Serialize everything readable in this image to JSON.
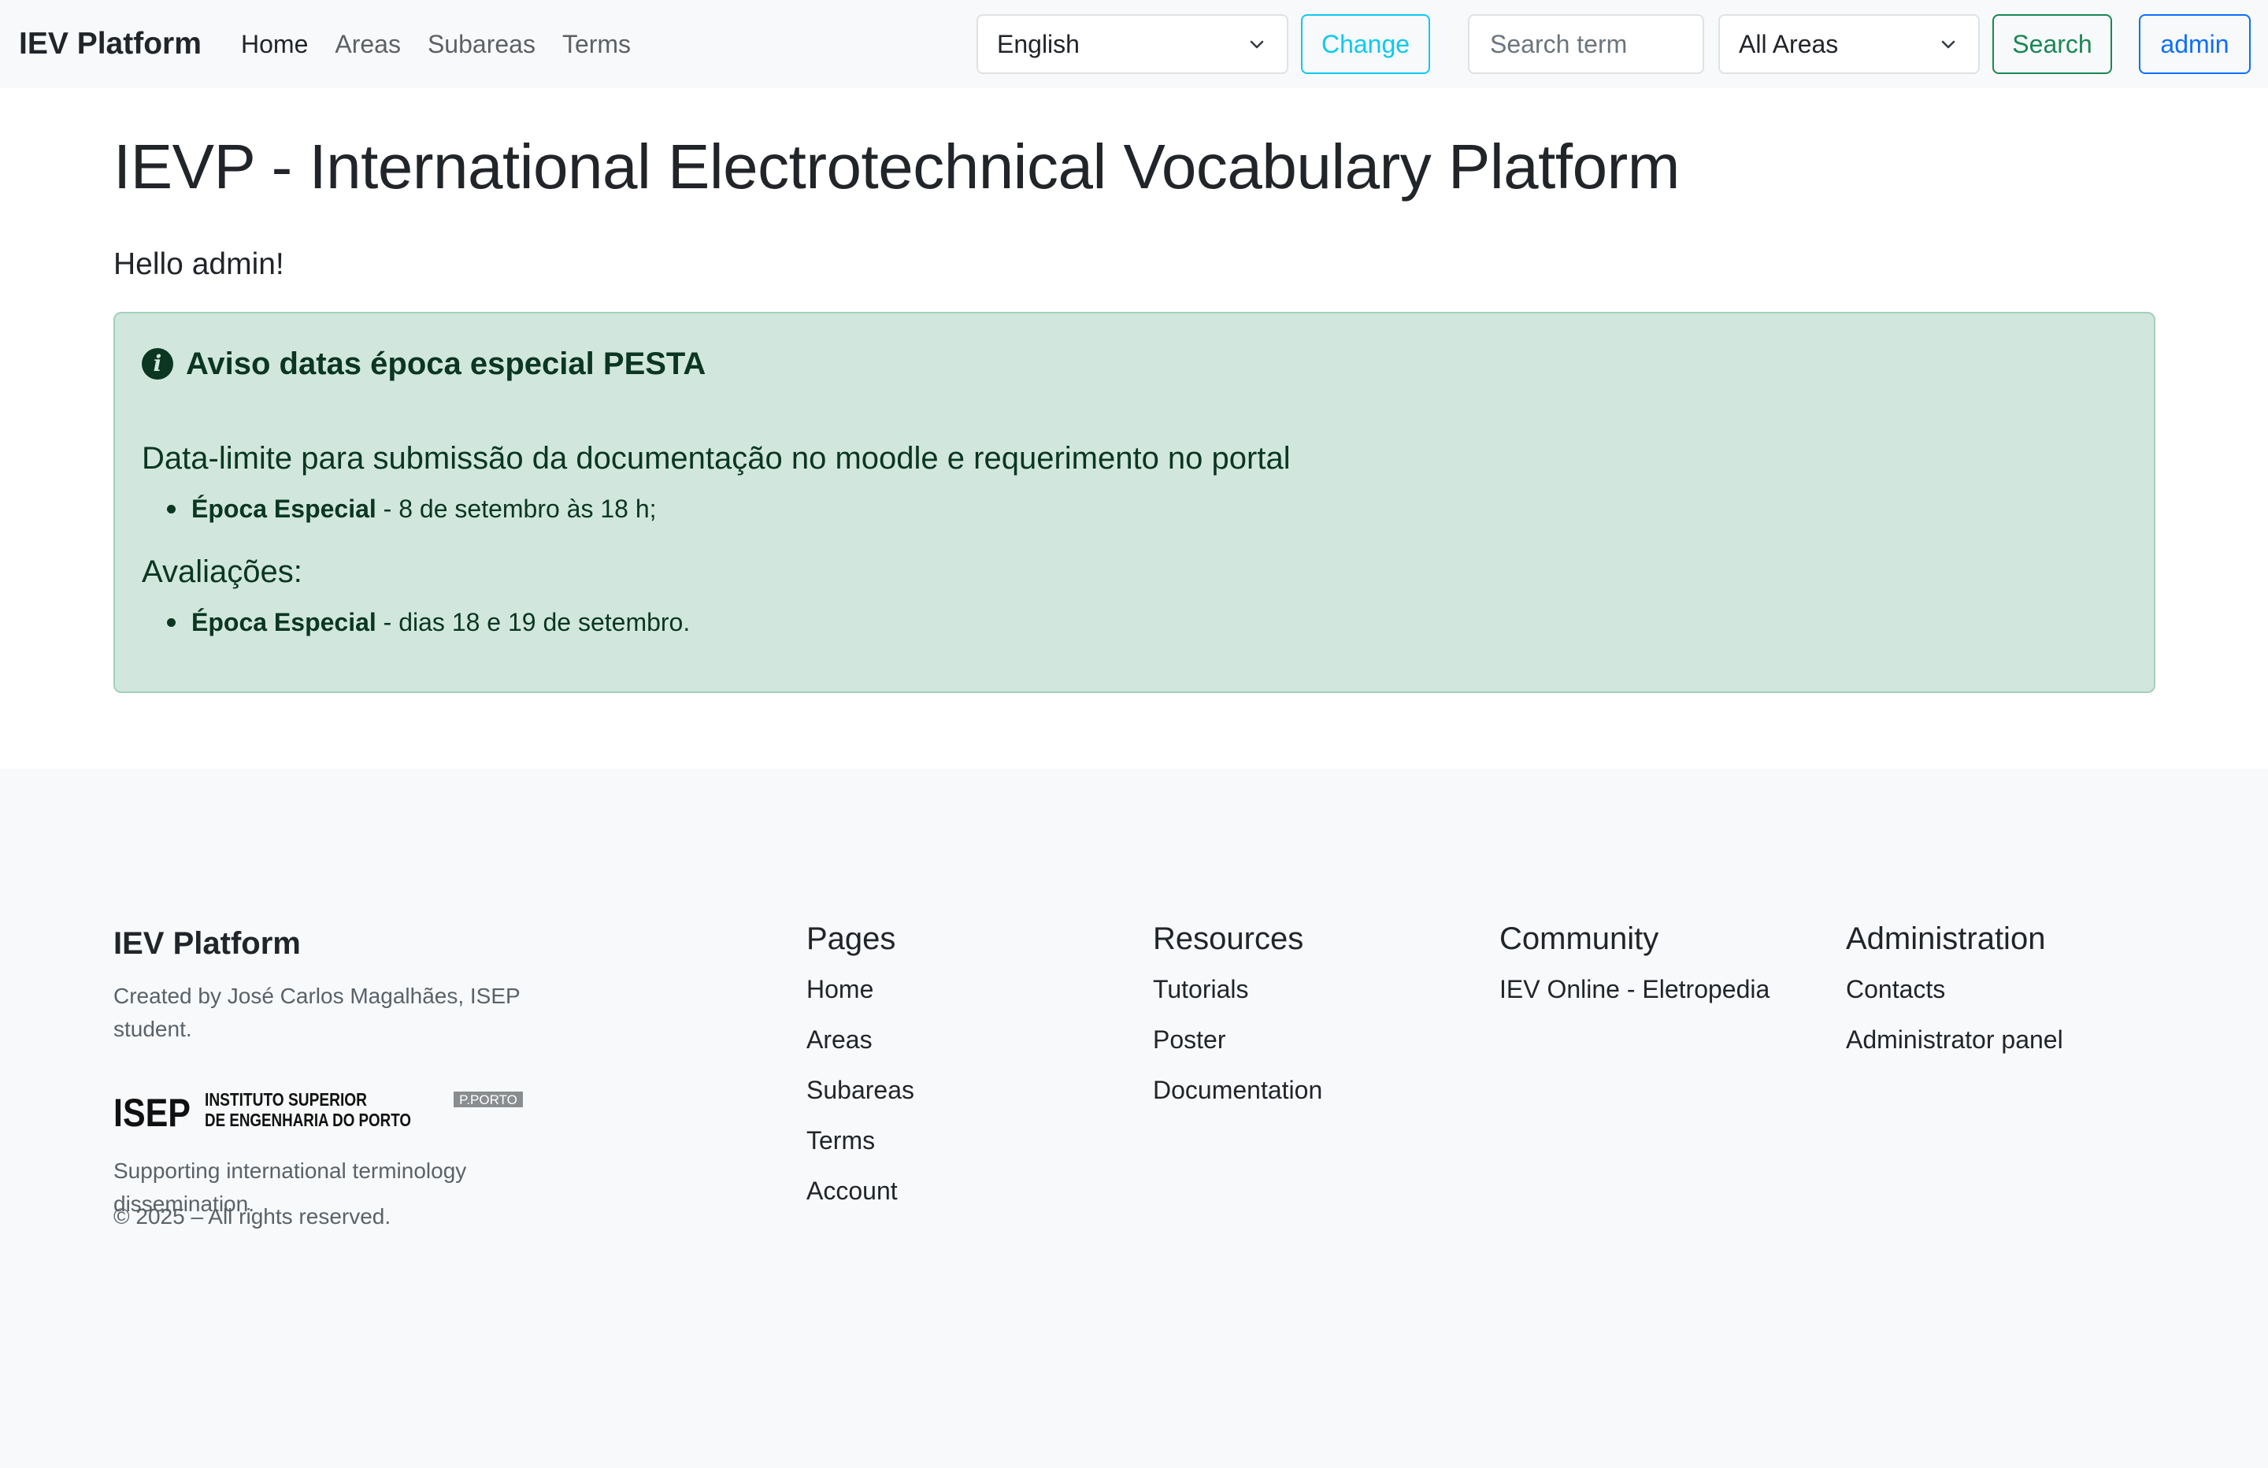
{
  "navbar": {
    "brand": "IEV Platform",
    "links": [
      "Home",
      "Areas",
      "Subareas",
      "Terms"
    ],
    "language_select": "English",
    "change_button": "Change",
    "search_placeholder": "Search term",
    "areas_select": "All Areas",
    "search_button": "Search",
    "user_button": "admin"
  },
  "main": {
    "title": "IEVP - International Electrotechnical Vocabulary Platform",
    "greeting": "Hello admin!",
    "alert": {
      "title": "Aviso datas época especial PESTA",
      "heading1": "Data-limite para submissão da documentação no moodle e requerimento no portal",
      "item1_bold": "Época Especial",
      "item1_text": " - 8 de setembro às 18 h;",
      "heading2": "Avaliações:",
      "item2_bold": "Época Especial",
      "item2_text": " - dias 18 e 19 de setembro."
    }
  },
  "footer": {
    "brand": "IEV Platform",
    "created_by": "Created by José Carlos Magalhães, ISEP student.",
    "logo": {
      "acronym": "ISEP",
      "line1": "INSTITUTO SUPERIOR",
      "line2": "DE ENGENHARIA DO PORTO",
      "badge": "P.PORTO"
    },
    "supporting": "Supporting international terminology dissemination.",
    "copyright": "© 2025 – All rights reserved.",
    "columns": [
      {
        "title": "Pages",
        "links": [
          "Home",
          "Areas",
          "Subareas",
          "Terms",
          "Account"
        ]
      },
      {
        "title": "Resources",
        "links": [
          "Tutorials",
          "Poster",
          "Documentation"
        ]
      },
      {
        "title": "Community",
        "links": [
          "IEV Online - Eletropedia"
        ]
      },
      {
        "title": "Administration",
        "links": [
          "Contacts",
          "Administrator panel"
        ]
      }
    ]
  },
  "colors": {
    "change_button": "#0dcaf0",
    "search_button": "#198754",
    "user_button": "#0d6efd",
    "alert_bg": "#d1e7dd",
    "alert_text": "#0a3622"
  }
}
